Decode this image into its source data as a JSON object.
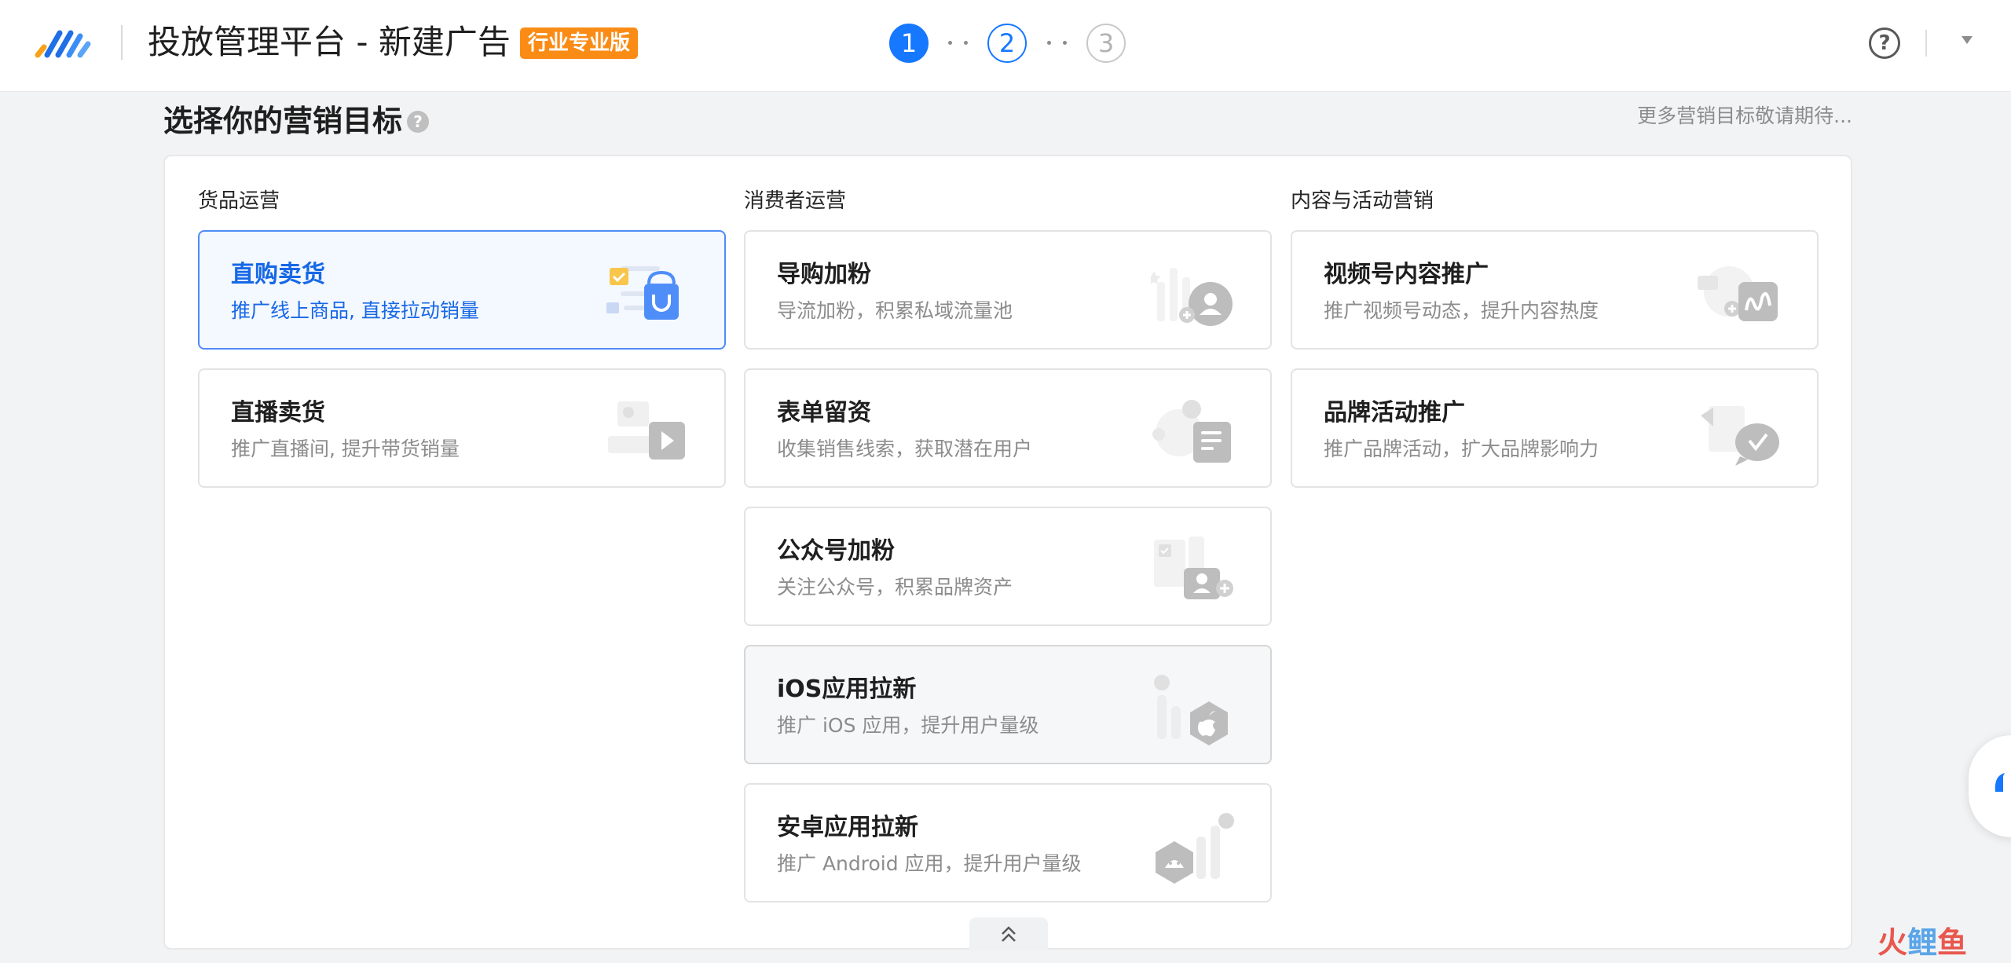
{
  "header": {
    "title": "投放管理平台 - 新建广告",
    "edition_badge": "行业专业版",
    "steps": [
      "1",
      "2",
      "3"
    ],
    "help_icon": "?"
  },
  "section": {
    "title": "选择你的营销目标",
    "help_icon": "?",
    "more_text": "更多营销目标敬请期待..."
  },
  "columns": [
    {
      "title": "货品运营",
      "cards": [
        {
          "title": "直购卖货",
          "desc": "推广线上商品, 直接拉动销量",
          "icon": "shopping-bag-icon",
          "selected": true
        },
        {
          "title": "直播卖货",
          "desc": "推广直播间, 提升带货销量",
          "icon": "live-play-icon"
        }
      ]
    },
    {
      "title": "消费者运营",
      "cards": [
        {
          "title": "导购加粉",
          "desc": "导流加粉，积累私域流量池",
          "icon": "add-user-icon"
        },
        {
          "title": "表单留资",
          "desc": "收集销售线索，获取潜在用户",
          "icon": "form-icon"
        },
        {
          "title": "公众号加粉",
          "desc": "关注公众号，积累品牌资产",
          "icon": "follow-account-icon"
        },
        {
          "title": "iOS应用拉新",
          "desc": "推广 iOS 应用，提升用户量级",
          "icon": "apple-icon",
          "hovered": true
        },
        {
          "title": "安卓应用拉新",
          "desc": "推广 Android 应用，提升用户量级",
          "icon": "android-icon"
        }
      ]
    },
    {
      "title": "内容与活动营销",
      "cards": [
        {
          "title": "视频号内容推广",
          "desc": "推广视频号动态，提升内容热度",
          "icon": "video-channel-icon"
        },
        {
          "title": "品牌活动推广",
          "desc": "推广品牌活动，扩大品牌影响力",
          "icon": "brand-activity-icon"
        }
      ]
    }
  ],
  "watermark": {
    "part1": "火",
    "part2": "鲤",
    "part3": "鱼"
  },
  "colors": {
    "accent": "#1677ff",
    "badge": "#fa8c16",
    "selected_text": "#1668e6"
  }
}
